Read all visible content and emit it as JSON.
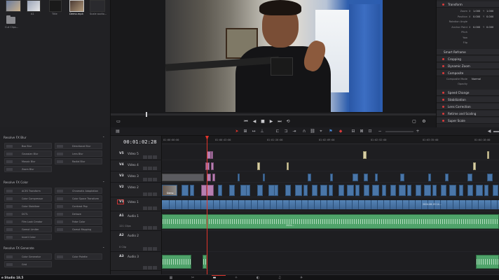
{
  "media_pool": {
    "clips": [
      {
        "label": ""
      },
      {
        "label": "A1"
      },
      {
        "label": "Title"
      },
      {
        "label": "Demo.mp4"
      },
      {
        "label": "Scale audio..."
      }
    ],
    "folder_label": "Cut Clips..."
  },
  "inspector": {
    "transform": "Transform",
    "rows": [
      {
        "label": "Zoom",
        "x": "X",
        "xval": "1.000",
        "y": "Y",
        "yval": "1.000"
      },
      {
        "label": "Position",
        "x": "X",
        "xval": "0.000",
        "y": "Y",
        "yval": "0.000"
      },
      {
        "label": "Rotation Angle",
        "x": "",
        "xval": "",
        "y": "",
        "yval": ""
      },
      {
        "label": "Anchor Point",
        "x": "X",
        "xval": "0.000",
        "y": "Y",
        "yval": "0.000"
      },
      {
        "label": "Pitch",
        "x": "",
        "xval": "",
        "y": "",
        "yval": ""
      },
      {
        "label": "Yaw",
        "x": "",
        "xval": "",
        "y": "",
        "yval": ""
      },
      {
        "label": "Flip",
        "x": "",
        "xval": "",
        "y": "",
        "yval": ""
      }
    ],
    "smart_reframe": "Smart Reframe",
    "cropping": "Cropping",
    "dynamic_zoom": "Dynamic Zoom",
    "composite": "Composite",
    "composite_mode_label": "Composite Mode",
    "composite_mode_value": "Normal",
    "opacity_label": "Opacity",
    "speed_change": "Speed Change",
    "stabilization": "Stabilization",
    "lens_correction": "Lens Correction",
    "retime_scaling": "Retime and Scaling",
    "super_scale": "Super Scale"
  },
  "effects": {
    "groups": [
      {
        "title": "Resolve FX Blur",
        "items": [
          "Box Blur",
          "Directional Blur",
          "Gaussian Blur",
          "Lens Blur",
          "Mosaic Blur",
          "Radial Blur",
          "Zoom Blur"
        ]
      },
      {
        "title": "Resolve FX Color",
        "items": [
          "ACES Transform",
          "Chromatic Adaptation",
          "Color Compressor",
          "Color Space Transform",
          "Color Stabilizer",
          "Contrast Pop",
          "DCTL",
          "Dehaze",
          "Film Look Creator",
          "False Color",
          "Gamut Limiter",
          "Gamut Mapping",
          "Invert Color"
        ]
      },
      {
        "title": "Resolve FX Generate",
        "items": [
          "Color Generator",
          "Color Palette",
          "Grid"
        ]
      }
    ]
  },
  "timeline": {
    "timecode": "00:01:02:28",
    "ruler": [
      "01:00:00:00",
      "01:00:43:00",
      "01:01:26:00",
      "01:02:09:00",
      "01:02:52:00",
      "01:03:35:00",
      "01:04:18:00"
    ],
    "tracks": [
      {
        "id": "V5",
        "name": "Video 5",
        "sub": ""
      },
      {
        "id": "V4",
        "name": "Video 4",
        "sub": ""
      },
      {
        "id": "V3",
        "name": "Video 3",
        "sub": ""
      },
      {
        "id": "V2",
        "name": "Video 2",
        "sub": ""
      },
      {
        "id": "V1",
        "name": "Video 1",
        "sub": ""
      },
      {
        "id": "A1",
        "name": "Audio 1",
        "sub": "121 Clips"
      },
      {
        "id": "A2",
        "name": "Audio 2",
        "sub": "0 Clip"
      },
      {
        "id": "A3",
        "name": "Audio 3",
        "sub": ""
      }
    ],
    "clip_labels": {
      "demo_clip": "Demo",
      "v1_label": "2024-08-29 14...",
      "a1_label": "2024-..."
    }
  },
  "page_bar": {
    "app_label": "e Studio 18.5",
    "pages": [
      {
        "icon": "media-icon",
        "glyph": "▦"
      },
      {
        "icon": "cut-icon",
        "glyph": "✂"
      },
      {
        "icon": "edit-icon",
        "glyph": "▬"
      },
      {
        "icon": "fusion-icon",
        "glyph": "✧"
      },
      {
        "icon": "color-icon",
        "glyph": "◐"
      },
      {
        "icon": "fairlight-icon",
        "glyph": "♫"
      },
      {
        "icon": "deliver-icon",
        "glyph": "✈"
      }
    ]
  },
  "colors": {
    "accent": "#e0342b",
    "video_clip": "#4a76a8",
    "audio_clip": "#4fa36a",
    "pink_clip": "#b77fb1",
    "beige_clip": "#d8cfa6"
  }
}
